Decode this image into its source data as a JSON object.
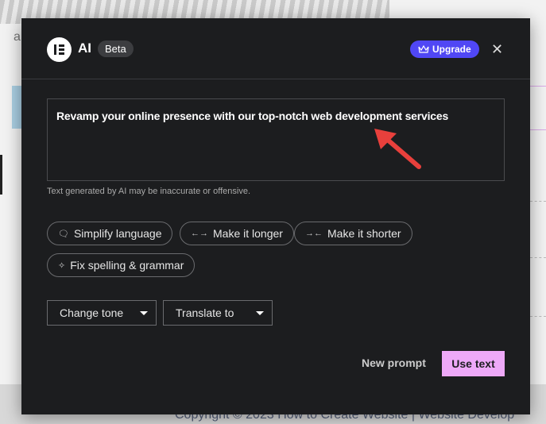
{
  "background": {
    "text_fragment": "a",
    "footer": "Copyright © 2023 How to Create Website | Website Develop"
  },
  "header": {
    "title": "AI",
    "badge": "Beta",
    "upgrade_label": "Upgrade",
    "close_icon": "close-icon",
    "logo": "elementor-logo"
  },
  "prompt": {
    "value": "Revamp your online presence with our top-notch web development services",
    "disclaimer": "Text generated by AI may be inaccurate or offensive."
  },
  "actions": [
    {
      "label": "Simplify language",
      "icon": "speech-bubble-icon"
    },
    {
      "label": "Make it longer",
      "icon": "expand-arrows-icon"
    },
    {
      "label": "Make it shorter",
      "icon": "collapse-arrows-icon"
    },
    {
      "label": "Fix spelling & grammar",
      "icon": "sparkle-icon"
    }
  ],
  "dropdowns": [
    {
      "label": "Change tone"
    },
    {
      "label": "Translate to"
    }
  ],
  "footer": {
    "new_prompt": "New prompt",
    "use_text": "Use text"
  },
  "colors": {
    "modal_bg": "#1c1d1f",
    "upgrade": "#5047f5",
    "use_text": "#eea9f8",
    "arrow": "#e8403c"
  }
}
